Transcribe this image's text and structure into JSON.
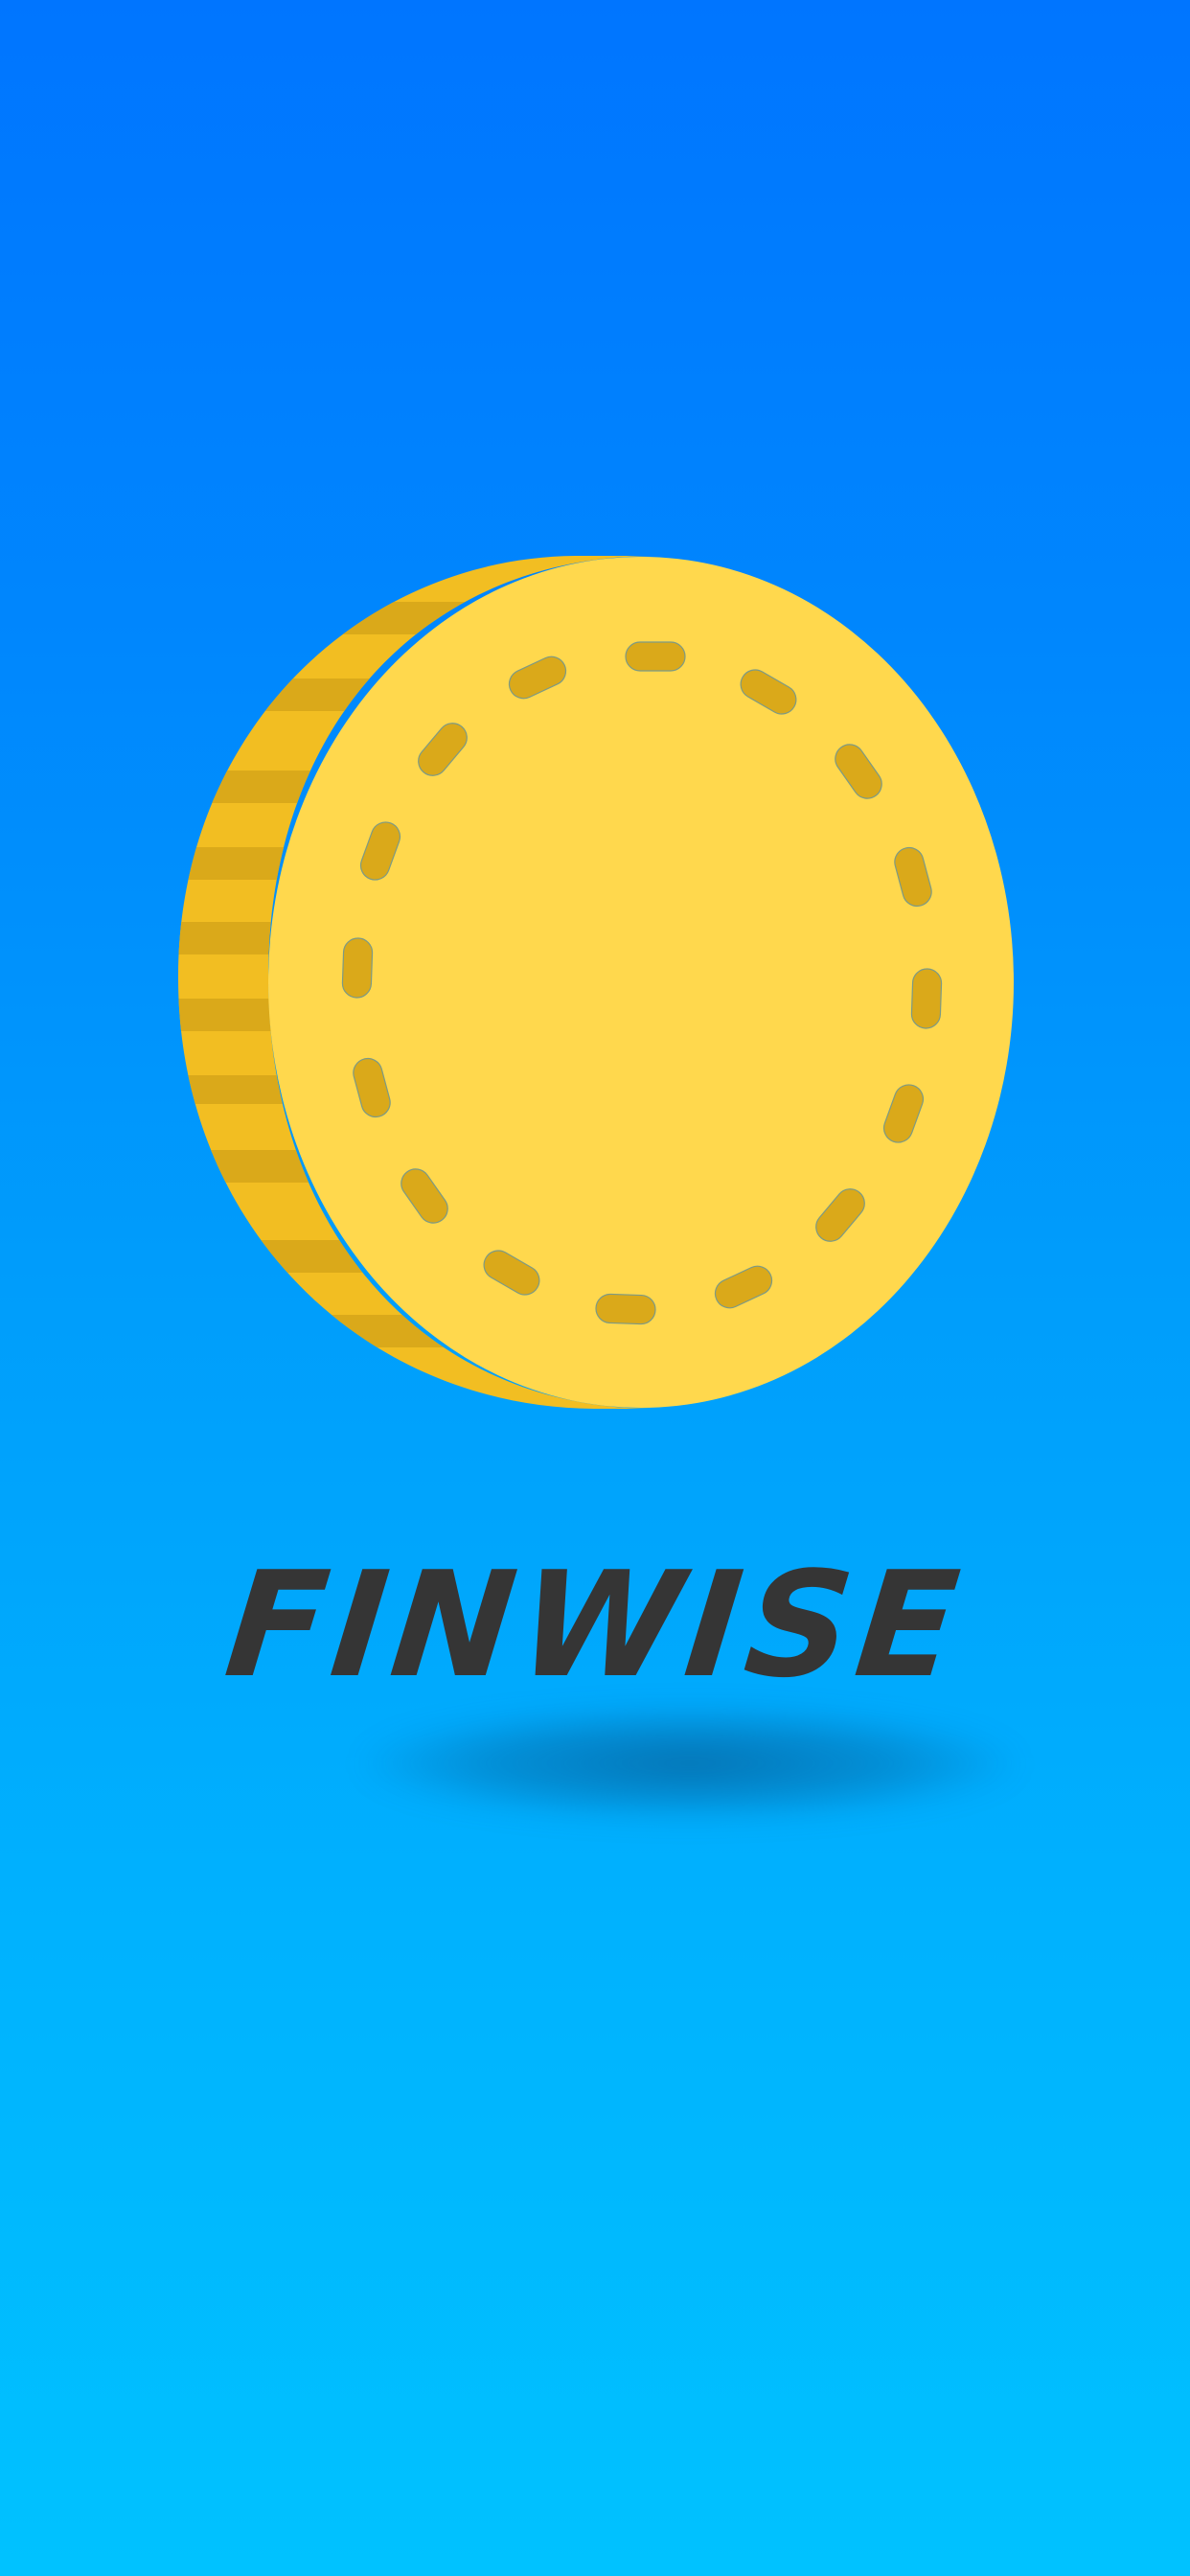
{
  "app": {
    "name": "FINWISE",
    "logo_icon": "gold-coin-icon"
  },
  "colors": {
    "background_top": "#0075ff",
    "background_bottom": "#00c2ff",
    "coin_face": "#ffd84d",
    "coin_edge": "#f2be22",
    "coin_marks": "#daa91a",
    "wordmark": "#353535"
  }
}
